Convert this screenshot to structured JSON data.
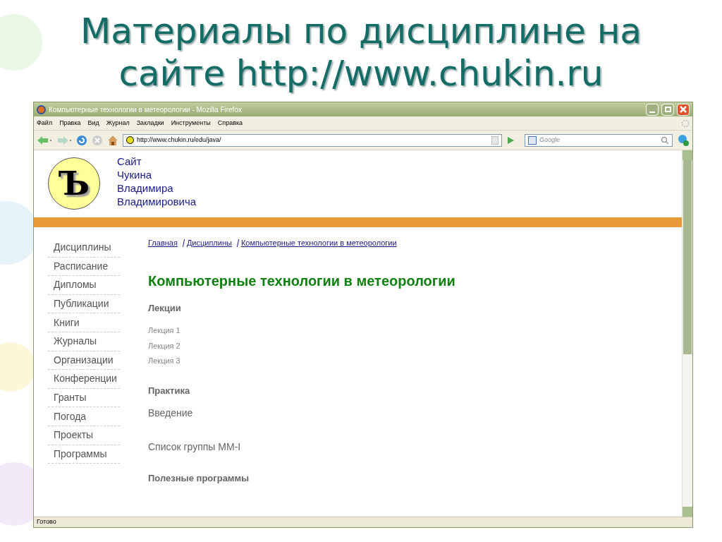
{
  "slide": {
    "title": "Материалы по дисциплине на сайте http://www.chukin.ru"
  },
  "window": {
    "title": "Компьютерные технологии в метеорологии - Mozilla Firefox"
  },
  "menu": [
    "Файл",
    "Правка",
    "Вид",
    "Журнал",
    "Закладки",
    "Инструменты",
    "Справка"
  ],
  "address": "http://www.chukin.ru/edu/java/",
  "search": {
    "placeholder": "Google"
  },
  "site": {
    "logo": "Ъ",
    "name_lines": [
      "Сайт",
      "Чукина",
      "Владимира",
      "Владимировича"
    ]
  },
  "sidebar": {
    "items": [
      "Дисциплины",
      "Расписание",
      "Дипломы",
      "Публикации",
      "Книги",
      "Журналы",
      "Организации",
      "Конференции",
      "Гранты",
      "Погода",
      "Проекты",
      "Программы"
    ]
  },
  "breadcrumb": [
    "Главная",
    "Дисциплины",
    "Компьютерные технологии в метеорологии"
  ],
  "heading": "Компьютерные технологии в метеорологии",
  "sections": [
    {
      "title": "Лекции",
      "kind": "small",
      "items": [
        "Лекция 1",
        "Лекция 2",
        "Лекция 3"
      ]
    },
    {
      "title": "Практика",
      "kind": "large",
      "items": [
        "Введение",
        "Список группы ММ-I"
      ]
    },
    {
      "title": "Полезные программы"
    }
  ],
  "status_bar": "Готово"
}
